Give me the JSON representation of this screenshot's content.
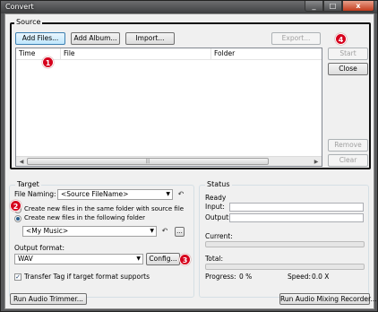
{
  "window": {
    "title": "Convert",
    "min_glyph": "_",
    "max_glyph": "□",
    "close_glyph": "x"
  },
  "source": {
    "group_title": "Source",
    "add_files_label": "Add Files...",
    "add_album_label": "Add Album...",
    "import_label": "Import...",
    "export_label": "Export...",
    "start_label": "Start",
    "close_label": "Close",
    "remove_label": "Remove",
    "clear_label": "Clear",
    "columns": [
      "Time",
      "File",
      "Folder"
    ]
  },
  "badges": [
    "1",
    "2",
    "3",
    "4"
  ],
  "badge_color": "#d6001c",
  "target": {
    "group_title": "Target",
    "file_naming_label": "File Naming:",
    "file_naming_value": "<Source FileName>",
    "radio_same_folder": "Create new files in the same folder with source file",
    "radio_following_folder": "Create new files in the following folder",
    "folder_value": "<My Music>",
    "browse_label": "...",
    "output_format_label": "Output format:",
    "output_format_value": "WAV",
    "config_label": "Config...",
    "transfer_tag_label": "Transfer Tag if target format supports",
    "transfer_tag_checked": true,
    "selected_radio": "following_folder"
  },
  "status": {
    "group_title": "Status",
    "state": "Ready",
    "input_label": "Input:",
    "output_label": "Output:",
    "current_label": "Current:",
    "total_label": "Total:",
    "progress_label": "Progress:",
    "progress_value": "0 %",
    "speed_label": "Speed:",
    "speed_value": "0.0 X",
    "current_fraction": 0,
    "total_fraction": 0
  },
  "bottom": {
    "run_trimmer_label": "Run Audio Trimmer...",
    "run_mixing_label": "Run Audio Mixing Recorder..."
  },
  "icons": {
    "undo": "↶",
    "dropdown": "▼",
    "scroll_left": "◀",
    "scroll_right": "▶",
    "grip": "|||",
    "check": "✓"
  }
}
